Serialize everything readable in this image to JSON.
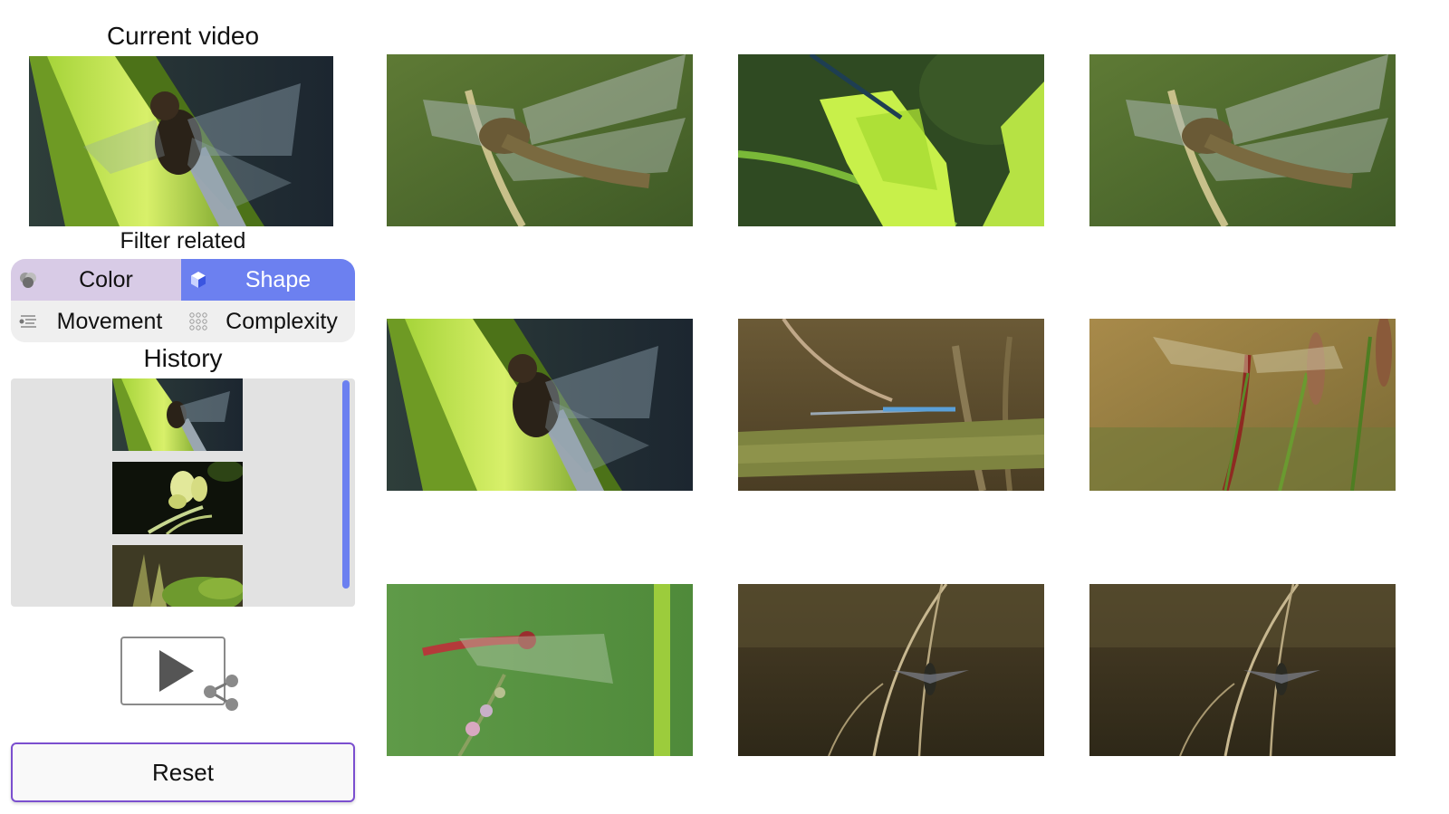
{
  "current": {
    "title": "Current video",
    "video_desc": "dragonfly on green stem, dark background"
  },
  "filter": {
    "title": "Filter related",
    "options": [
      {
        "label": "Color",
        "icon": "color-circles-icon",
        "selected": false
      },
      {
        "label": "Shape",
        "icon": "cube-icon",
        "selected": true
      },
      {
        "label": "Movement",
        "icon": "movement-lines-icon",
        "selected": false
      },
      {
        "label": "Complexity",
        "icon": "dot-grid-icon",
        "selected": false
      }
    ]
  },
  "history": {
    "title": "History",
    "items": [
      "dragonfly-stem",
      "orchid-flower",
      "green-leaves"
    ]
  },
  "actions": {
    "share_icon": "play-share-icon",
    "reset_label": "Reset"
  },
  "colors": {
    "accent": "#6c80f0",
    "filter_color_bg": "#d8cbe6",
    "reset_border": "#7b4fcf",
    "history_bg": "#e2e2e2"
  },
  "results": [
    "dragonfly-on-twig",
    "damselfly-on-leaf",
    "dragonfly-on-twig",
    "dragonfly-on-stem",
    "damselfly-on-branch",
    "red-dragonfly-on-reed",
    "red-dragonfly-on-flower",
    "dragonfly-among-grass",
    "dragonfly-among-grass"
  ]
}
